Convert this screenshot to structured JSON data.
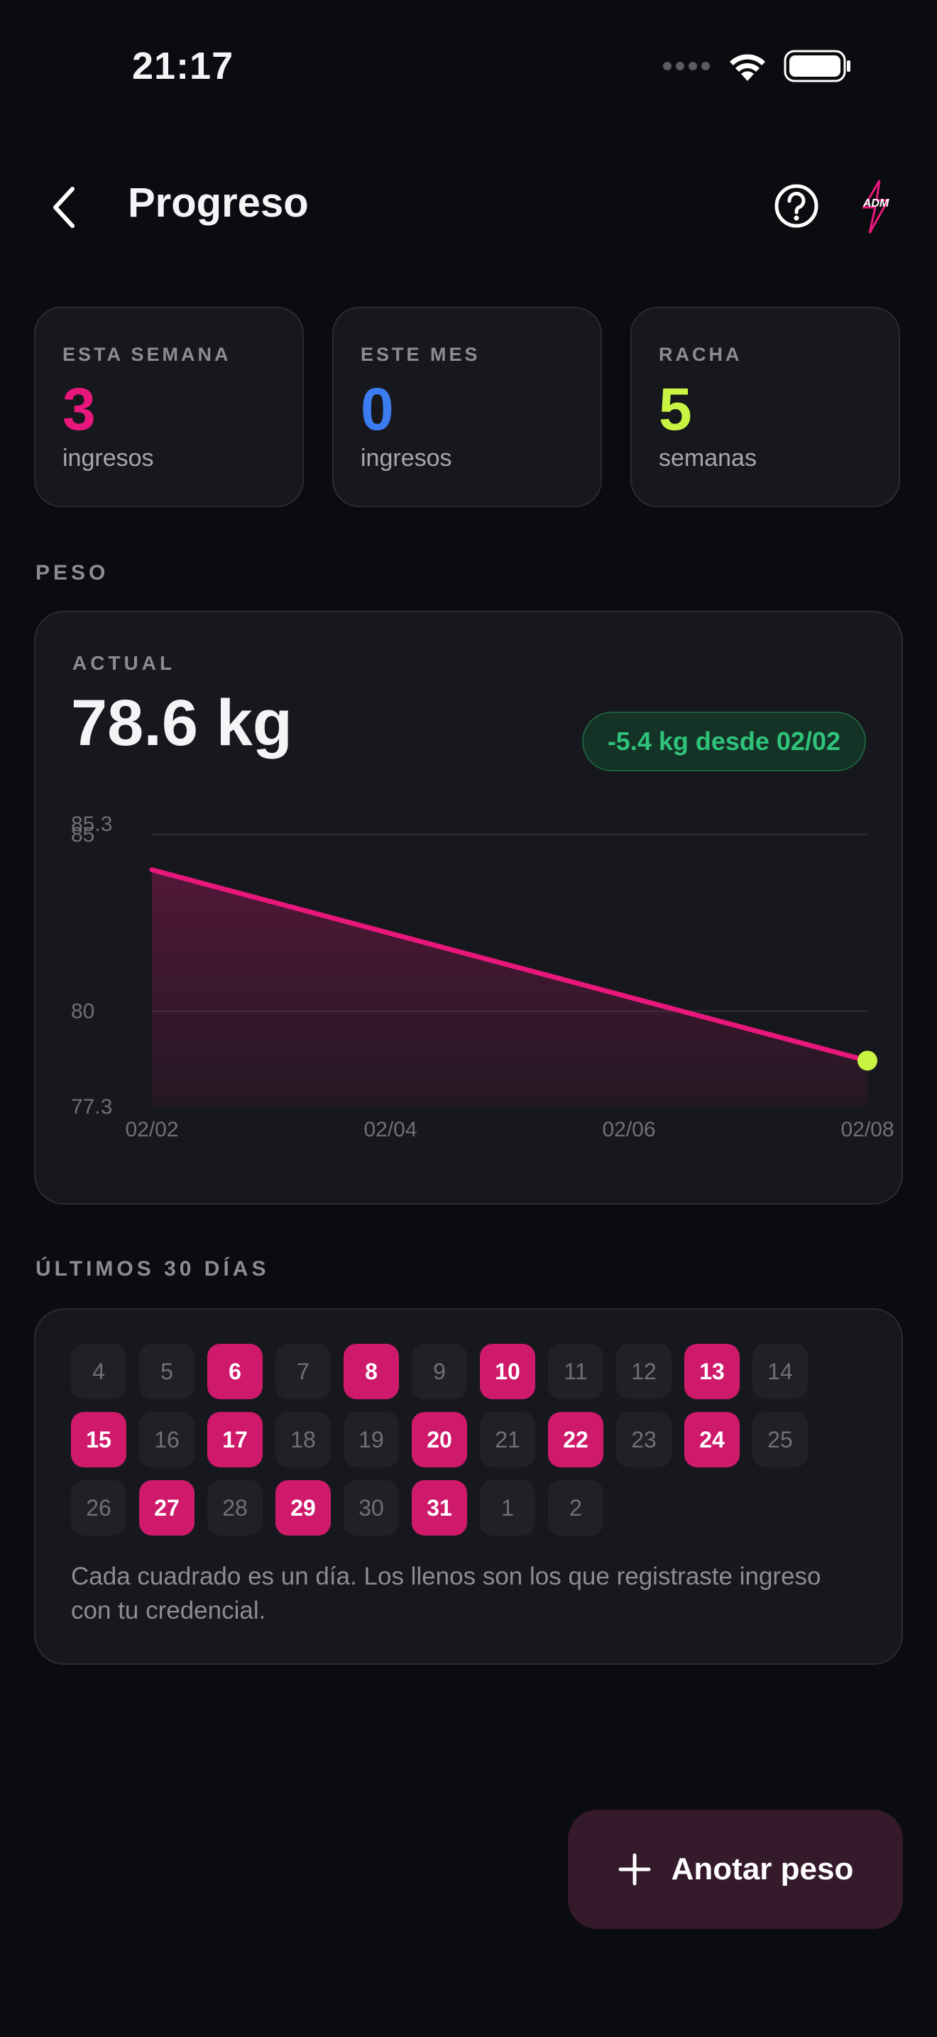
{
  "status_bar": {
    "time": "21:17"
  },
  "header": {
    "title": "Progreso",
    "logo_text": "ADM"
  },
  "stats": [
    {
      "label": "ESTA SEMANA",
      "value": "3",
      "unit": "ingresos",
      "color": "#e8177b"
    },
    {
      "label": "ESTE MES",
      "value": "0",
      "unit": "ingresos",
      "color": "#3b7cf0"
    },
    {
      "label": "RACHA",
      "value": "5",
      "unit": "semanas",
      "color": "#c9f542"
    }
  ],
  "weight": {
    "section_title": "PESO",
    "actual_label": "ACTUAL",
    "actual_value": "78.6 kg",
    "delta": "-5.4 kg desde 02/02"
  },
  "chart_data": {
    "type": "area",
    "x": [
      "02/02",
      "02/08"
    ],
    "values": [
      84.0,
      78.6
    ],
    "xticks": [
      "02/02",
      "02/04",
      "02/06",
      "02/08"
    ],
    "yticks": [
      "85.3",
      "85",
      "80",
      "77.3"
    ],
    "ylim": [
      77.3,
      85.3
    ],
    "line_color": "#e8177b",
    "end_point_color": "#c9f542",
    "grid": true
  },
  "calendar": {
    "section_title": "ÚLTIMOS 30 DÍAS",
    "days": [
      {
        "d": "4",
        "f": false
      },
      {
        "d": "5",
        "f": false
      },
      {
        "d": "6",
        "f": true
      },
      {
        "d": "7",
        "f": false
      },
      {
        "d": "8",
        "f": true
      },
      {
        "d": "9",
        "f": false
      },
      {
        "d": "10",
        "f": true
      },
      {
        "d": "11",
        "f": false
      },
      {
        "d": "12",
        "f": false
      },
      {
        "d": "13",
        "f": true
      },
      {
        "d": "14",
        "f": false
      },
      {
        "d": "15",
        "f": true
      },
      {
        "d": "16",
        "f": false
      },
      {
        "d": "17",
        "f": true
      },
      {
        "d": "18",
        "f": false
      },
      {
        "d": "19",
        "f": false
      },
      {
        "d": "20",
        "f": true
      },
      {
        "d": "21",
        "f": false
      },
      {
        "d": "22",
        "f": true
      },
      {
        "d": "23",
        "f": false
      },
      {
        "d": "24",
        "f": true
      },
      {
        "d": "25",
        "f": false
      },
      {
        "d": "26",
        "f": false
      },
      {
        "d": "27",
        "f": true
      },
      {
        "d": "28",
        "f": false
      },
      {
        "d": "29",
        "f": true
      },
      {
        "d": "30",
        "f": false
      },
      {
        "d": "31",
        "f": true
      },
      {
        "d": "1",
        "f": false
      },
      {
        "d": "2",
        "f": false
      }
    ],
    "note": "Cada cuadrado es un día. Los llenos son los que registraste ingreso con tu credencial."
  },
  "fab": {
    "label": "Anotar peso"
  }
}
